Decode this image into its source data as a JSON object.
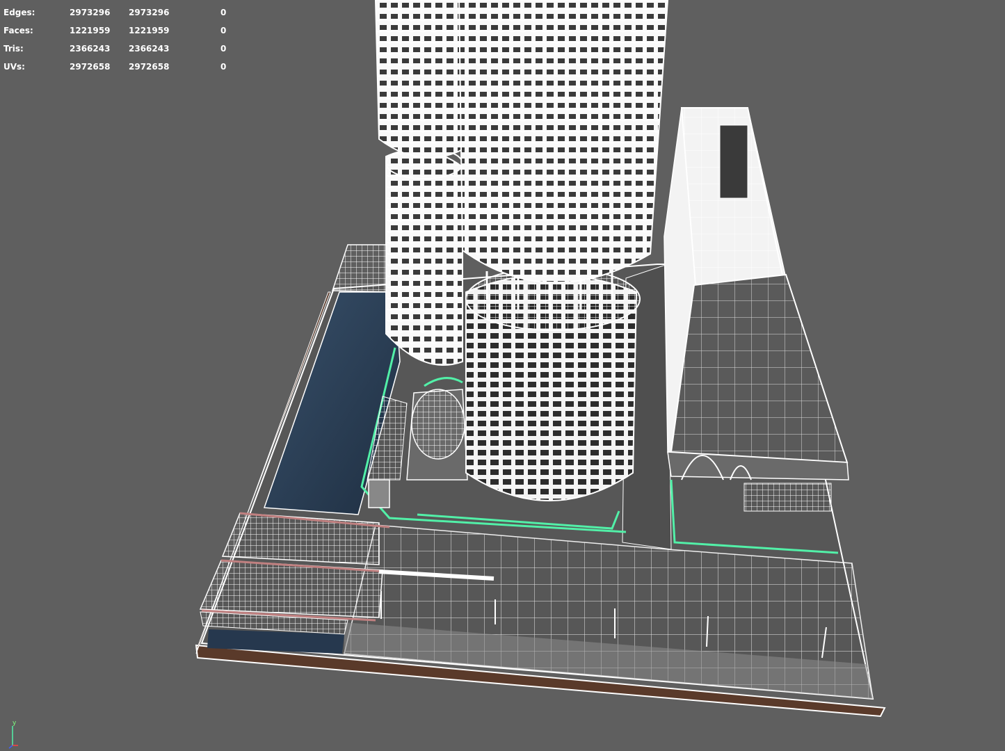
{
  "stats": {
    "rows": [
      {
        "label": "Edges:",
        "v1": "2973296",
        "v2": "2973296",
        "v3": "0"
      },
      {
        "label": "Faces:",
        "v1": "1221959",
        "v2": "1221959",
        "v3": "0"
      },
      {
        "label": "Tris:",
        "v1": "2366243",
        "v2": "2366243",
        "v3": "0"
      },
      {
        "label": "UVs:",
        "v1": "2972658",
        "v2": "2972658",
        "v3": "0"
      }
    ]
  },
  "axis": {
    "y_label": "y"
  },
  "colors": {
    "background": "#5f5f5f",
    "wire": "#ffffff",
    "selection": "#52f0a8",
    "water": "#26384e",
    "base": "#5a3a2a",
    "ground": "#565656",
    "road": "#6e6e6e"
  }
}
